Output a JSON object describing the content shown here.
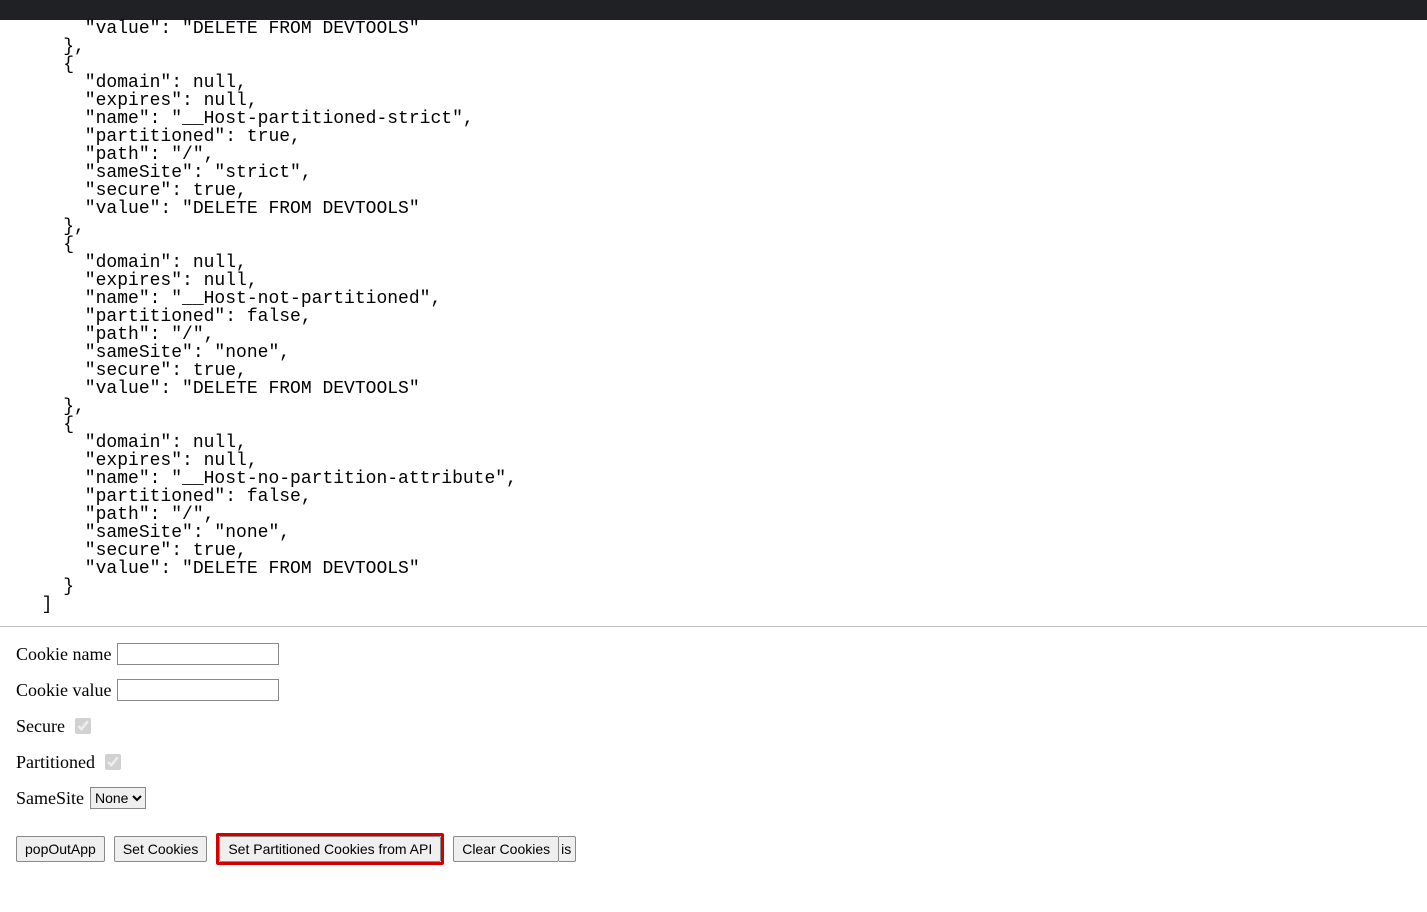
{
  "json_text": "      \"value\": \"DELETE FROM DEVTOOLS\"\n    },\n    {\n      \"domain\": null,\n      \"expires\": null,\n      \"name\": \"__Host-partitioned-strict\",\n      \"partitioned\": true,\n      \"path\": \"/\",\n      \"sameSite\": \"strict\",\n      \"secure\": true,\n      \"value\": \"DELETE FROM DEVTOOLS\"\n    },\n    {\n      \"domain\": null,\n      \"expires\": null,\n      \"name\": \"__Host-not-partitioned\",\n      \"partitioned\": false,\n      \"path\": \"/\",\n      \"sameSite\": \"none\",\n      \"secure\": true,\n      \"value\": \"DELETE FROM DEVTOOLS\"\n    },\n    {\n      \"domain\": null,\n      \"expires\": null,\n      \"name\": \"__Host-no-partition-attribute\",\n      \"partitioned\": false,\n      \"path\": \"/\",\n      \"sameSite\": \"none\",\n      \"secure\": true,\n      \"value\": \"DELETE FROM DEVTOOLS\"\n    }\n  ]",
  "form": {
    "cookie_name_label": "Cookie name",
    "cookie_name_value": "",
    "cookie_value_label": "Cookie value",
    "cookie_value_value": "",
    "secure_label": "Secure",
    "partitioned_label": "Partitioned",
    "samesite_label": "SameSite",
    "samesite_selected": "None"
  },
  "buttons": {
    "popout": "popOutApp",
    "set_cookies": "Set  Cookies",
    "set_partitioned": "Set Partitioned Cookies from API",
    "clear_cookies": "Clear Cookies",
    "overflow_fragment": "is"
  }
}
